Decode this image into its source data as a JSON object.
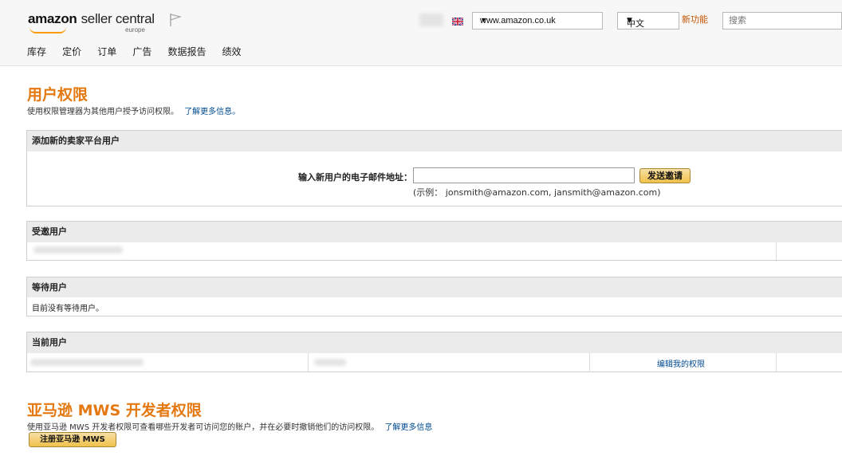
{
  "header": {
    "logo_brand": "amazon",
    "logo_product": "seller central",
    "logo_region": "europe",
    "site_select_value": "www.amazon.co.uk",
    "language_select_value": "中文",
    "new_features_link": "新功能",
    "search_placeholder": "搜索"
  },
  "nav": {
    "items": [
      {
        "label": "库存"
      },
      {
        "label": "定价"
      },
      {
        "label": "订单"
      },
      {
        "label": "广告"
      },
      {
        "label": "数据报告"
      },
      {
        "label": "绩效"
      }
    ]
  },
  "user_permissions": {
    "title": "用户权限",
    "description": "使用权限管理器为其他用户授予访问权限。",
    "learn_more": "了解更多信息。"
  },
  "add_user": {
    "header": "添加新的卖家平台用户",
    "email_label": "输入新用户的电子邮件地址：",
    "email_value": "",
    "send_button": "发送邀请",
    "example_text": "(示例： jonsmith@amazon.com, jansmith@amazon.com)"
  },
  "invited_users": {
    "header": "受邀用户"
  },
  "pending_users": {
    "header": "等待用户",
    "empty_text": "目前没有等待用户。"
  },
  "current_users": {
    "header": "当前用户",
    "edit_link": "编辑我的权限"
  },
  "mws": {
    "title": "亚马逊 MWS 开发者权限",
    "description": "使用亚马逊 MWS 开发者权限可查看哪些开发者可访问您的账户，并在必要时撤销他们的访问权限。",
    "learn_more": "了解更多信息",
    "register_button": "注册亚马逊 MWS"
  },
  "colors": {
    "accent_orange": "#e47911",
    "link_blue": "#004b91",
    "button_gold": "#f0c14b"
  }
}
